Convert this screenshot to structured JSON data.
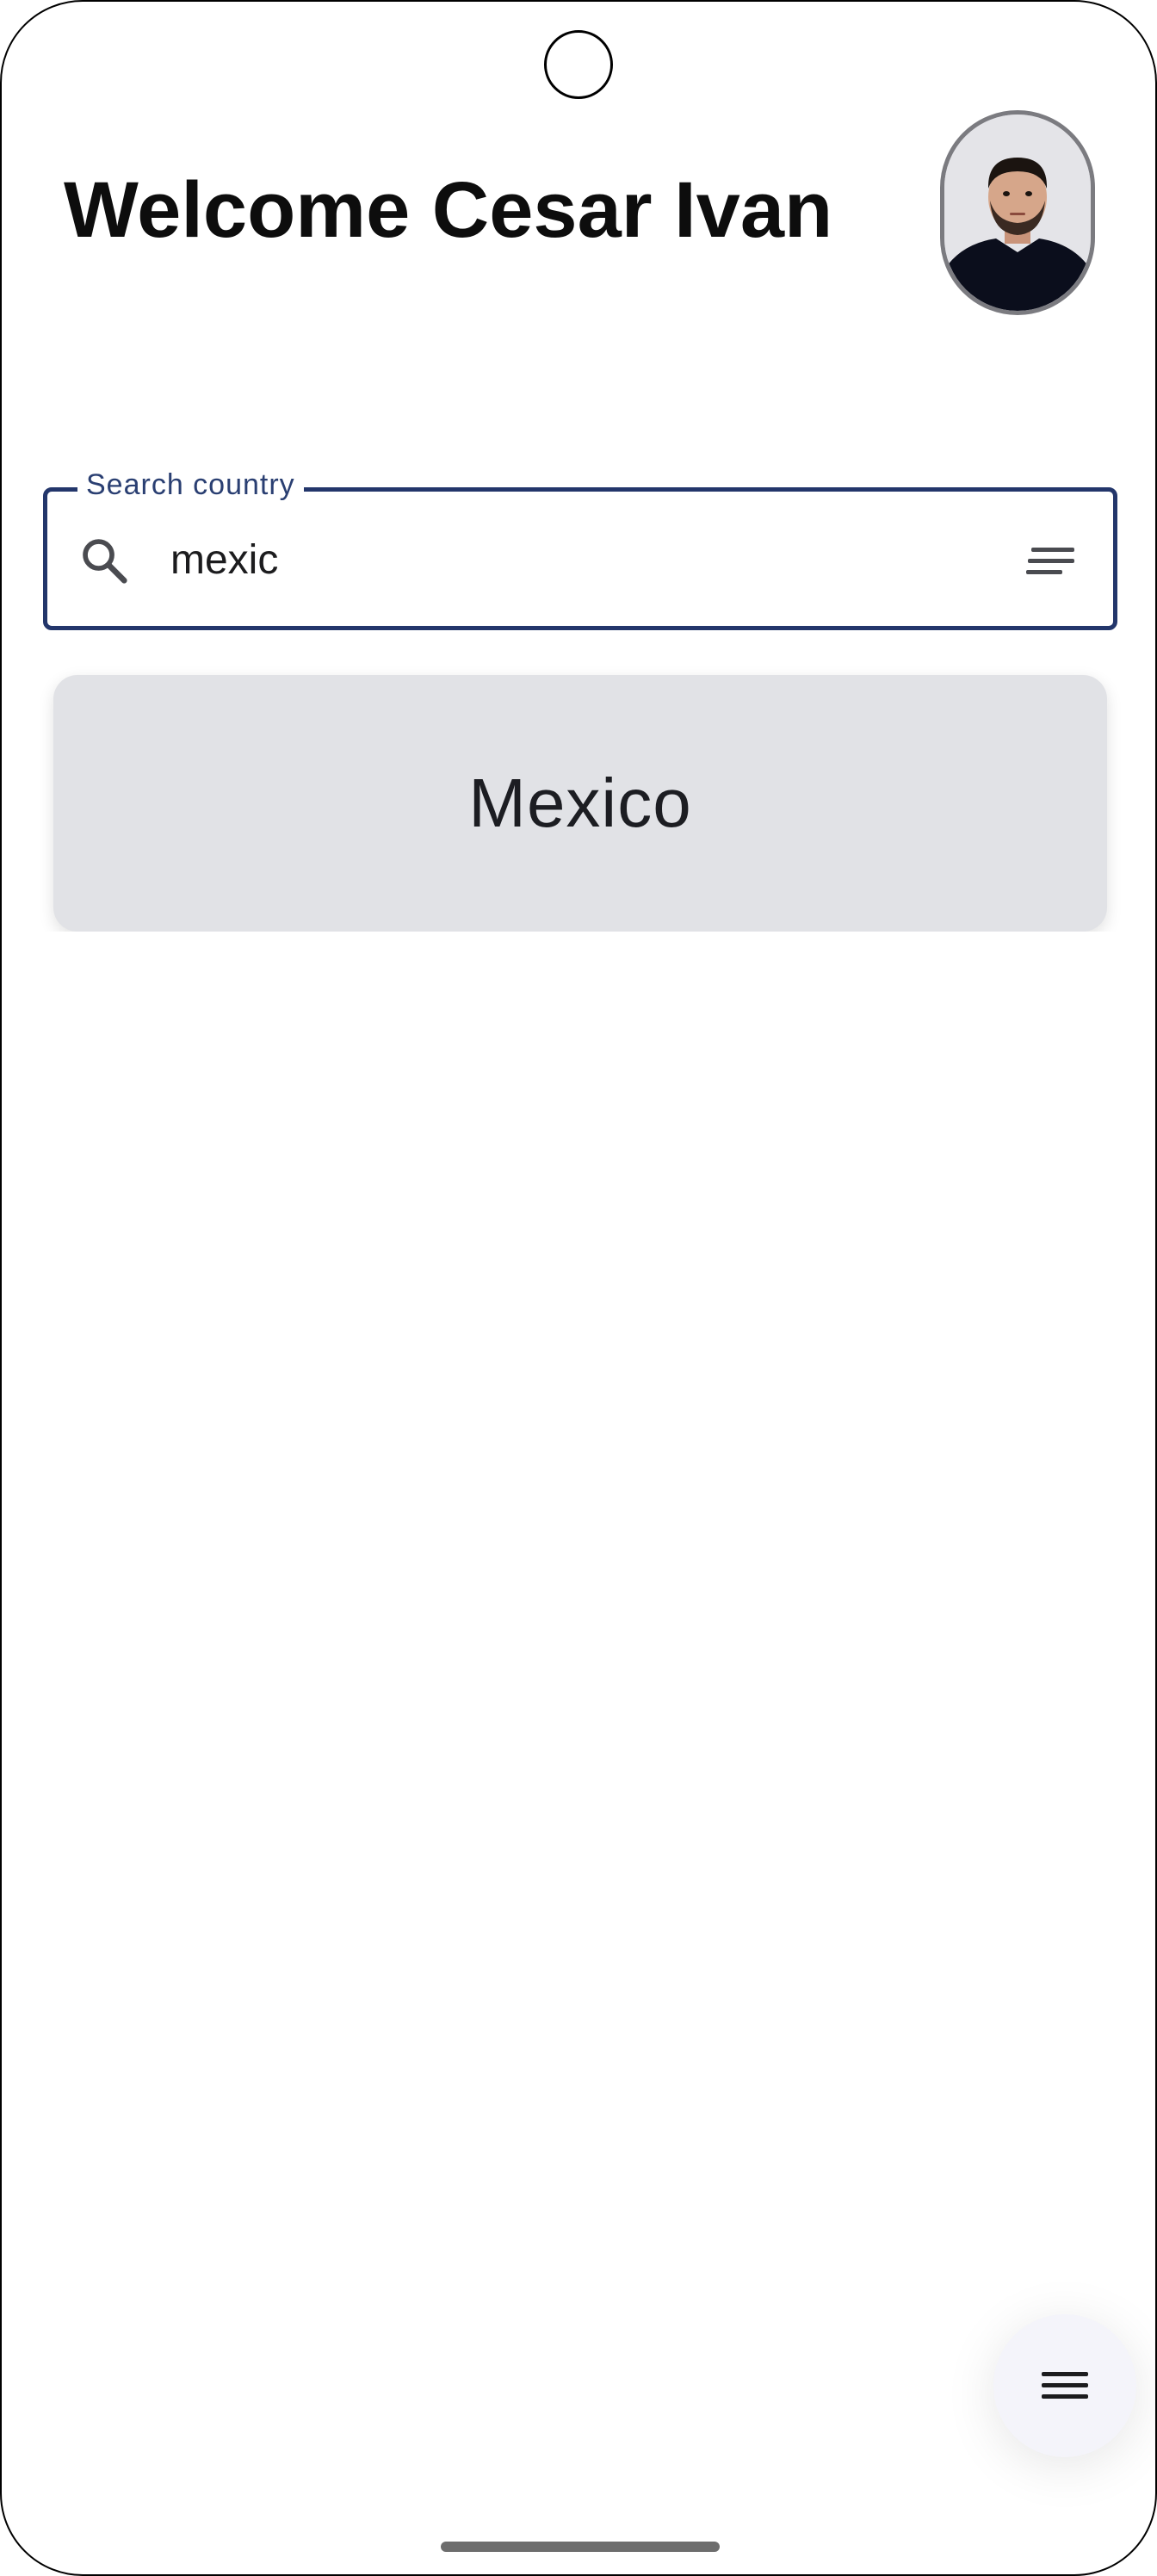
{
  "header": {
    "welcome_text": "Welcome Cesar Ivan"
  },
  "avatar": {
    "icon": "user-photo"
  },
  "search": {
    "label": "Search country",
    "value": "mexic",
    "search_icon": "search-icon",
    "filter_icon": "sort-filter-icon"
  },
  "results": [
    {
      "name": "Mexico"
    }
  ],
  "fab": {
    "icon": "menu-icon"
  },
  "colors": {
    "accent": "#23366b",
    "card_background": "#e1e2e6",
    "fab_background": "#f4f4fa"
  }
}
